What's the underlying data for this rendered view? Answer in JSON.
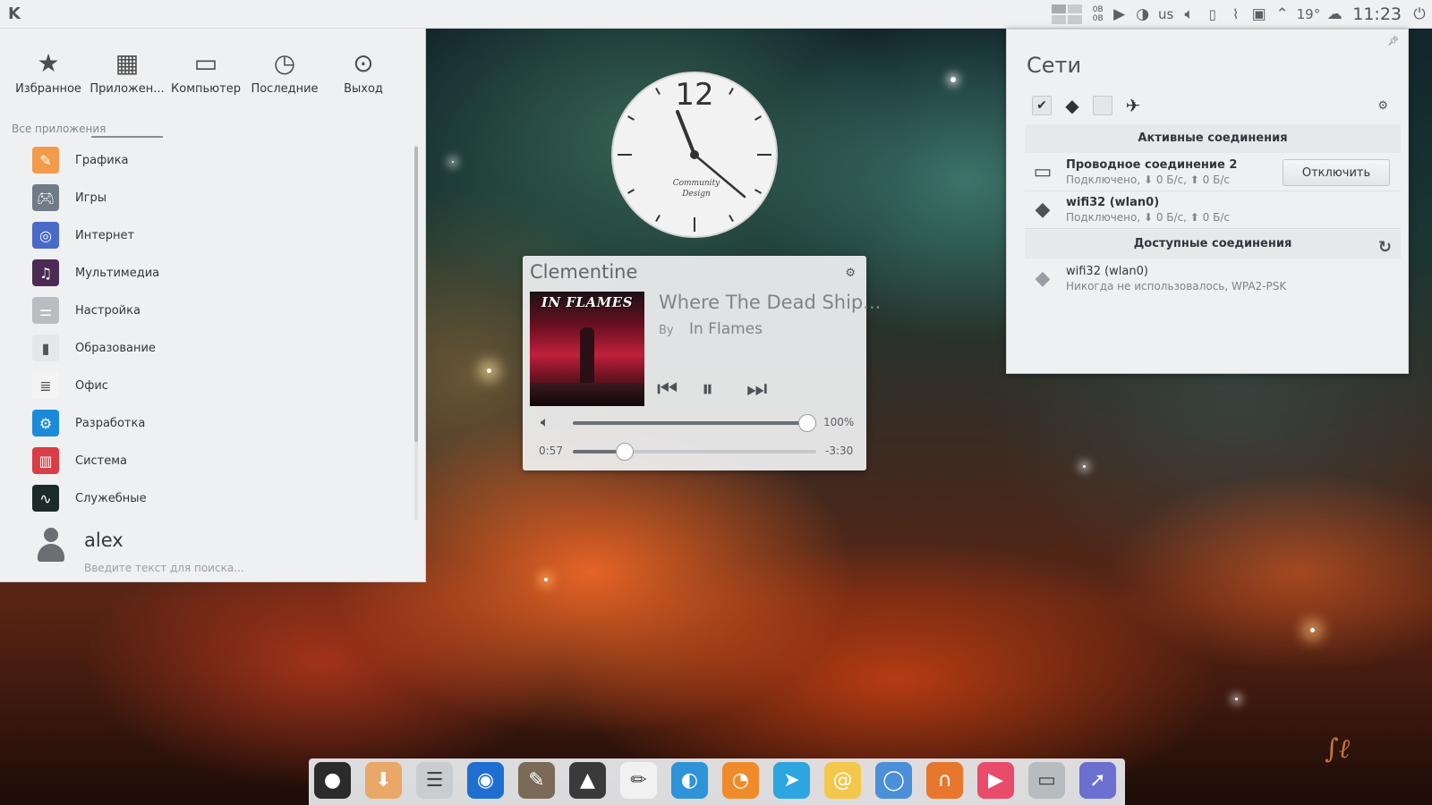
{
  "top_panel": {
    "launcher_icon": "kde-icon",
    "netspeed_up": "0B",
    "netspeed_down": "0B",
    "keyboard_layout": "us",
    "temperature": "19°",
    "time": "11:23",
    "tray_icons": [
      "pager-icon",
      "netspeed-icon",
      "play-icon",
      "clementine-icon",
      "keyboard-layout",
      "volume-icon",
      "battery-icon",
      "clipboard-icon",
      "network-icon",
      "expand-arrow-icon",
      "weather-icon",
      "power-icon"
    ]
  },
  "kickoff": {
    "tabs": [
      {
        "label": "Избранное",
        "icon": "star-icon"
      },
      {
        "label": "Приложен...",
        "icon": "apps-grid-icon"
      },
      {
        "label": "Компьютер",
        "icon": "computer-icon"
      },
      {
        "label": "Последние",
        "icon": "history-icon"
      },
      {
        "label": "Выход",
        "icon": "logout-icon"
      }
    ],
    "active_tab": 1,
    "section_label": "Все приложения",
    "apps": [
      {
        "label": "Графика",
        "icon": "graphics-icon",
        "color": "#f29b4b"
      },
      {
        "label": "Игры",
        "icon": "games-icon",
        "color": "#6f7b87"
      },
      {
        "label": "Интернет",
        "icon": "internet-icon",
        "color": "#4a6ac8"
      },
      {
        "label": "Мультимедиа",
        "icon": "multimedia-icon",
        "color": "#4b2c53"
      },
      {
        "label": "Настройка",
        "icon": "settings-icon",
        "color": "#b9bdc2"
      },
      {
        "label": "Образование",
        "icon": "education-icon",
        "color": "#e6e7e8"
      },
      {
        "label": "Офис",
        "icon": "office-icon",
        "color": "#f4f4f4"
      },
      {
        "label": "Разработка",
        "icon": "development-icon",
        "color": "#1c8ad8"
      },
      {
        "label": "Система",
        "icon": "system-icon",
        "color": "#d93d45"
      },
      {
        "label": "Служебные",
        "icon": "utilities-icon",
        "color": "#1d2a2a"
      }
    ],
    "user_name": "alex",
    "search_placeholder": "Введите текст для поиска..."
  },
  "clock": {
    "label_12": "12",
    "brand_line1": "Community",
    "brand_line2": "Design"
  },
  "clementine": {
    "title": "Clementine",
    "track_title": "Where The Dead Ship...",
    "by_label": "By",
    "artist": "In Flames",
    "album_text": "IN FLAMES",
    "volume_percent": 100,
    "volume_text": "100%",
    "elapsed": "0:57",
    "remaining": "-3:30",
    "progress_fraction": 0.215
  },
  "network": {
    "title": "Сети",
    "active_header": "Активные соединения",
    "available_header": "Доступные соединения",
    "active": [
      {
        "name": "Проводное соединение 2",
        "status": "Подключено, ⬇ 0 Б/с, ⬆ 0 Б/с",
        "icon": "wired-network-icon",
        "action": "Отключить"
      },
      {
        "name": "wifi32 (wlan0)",
        "status": "Подключено, ⬇ 0 Б/с, ⬆ 0 Б/с",
        "icon": "wifi-locked-icon"
      }
    ],
    "available": [
      {
        "name": "wifi32 (wlan0)",
        "status": "Никогда не использовалось, WPA2-PSK",
        "icon": "wifi-locked-icon"
      }
    ]
  },
  "dock": {
    "apps": [
      {
        "name": "github-icon",
        "color": "#2b2b2b",
        "glyph": "●"
      },
      {
        "name": "download-icon",
        "color": "#e9a868",
        "glyph": "⬇"
      },
      {
        "name": "settings-toggle-icon",
        "color": "#c9cdd2",
        "glyph": "☰"
      },
      {
        "name": "browser-globe-icon",
        "color": "#1f6fd1",
        "glyph": "◉"
      },
      {
        "name": "gimp-icon",
        "color": "#7b6a57",
        "glyph": "✎"
      },
      {
        "name": "inkscape-icon",
        "color": "#3a3a3a",
        "glyph": "▲"
      },
      {
        "name": "text-editor-icon",
        "color": "#f1f1f1",
        "glyph": "✏"
      },
      {
        "name": "telegram-alt-icon",
        "color": "#2e93d7",
        "glyph": "◐"
      },
      {
        "name": "rss-icon",
        "color": "#f08b2c",
        "glyph": "◔"
      },
      {
        "name": "telegram-icon",
        "color": "#2ca5e0",
        "glyph": "➤"
      },
      {
        "name": "mail-icon",
        "color": "#f3c74a",
        "glyph": "@"
      },
      {
        "name": "chromium-icon",
        "color": "#4a8fd8",
        "glyph": "◯"
      },
      {
        "name": "headphones-icon",
        "color": "#e8762d",
        "glyph": "∩"
      },
      {
        "name": "media-player-icon",
        "color": "#e94b6a",
        "glyph": "▶"
      },
      {
        "name": "file-manager-icon",
        "color": "#b8bcc0",
        "glyph": "▭"
      },
      {
        "name": "cursor-icon",
        "color": "#6a6fd0",
        "glyph": "➚"
      }
    ]
  }
}
